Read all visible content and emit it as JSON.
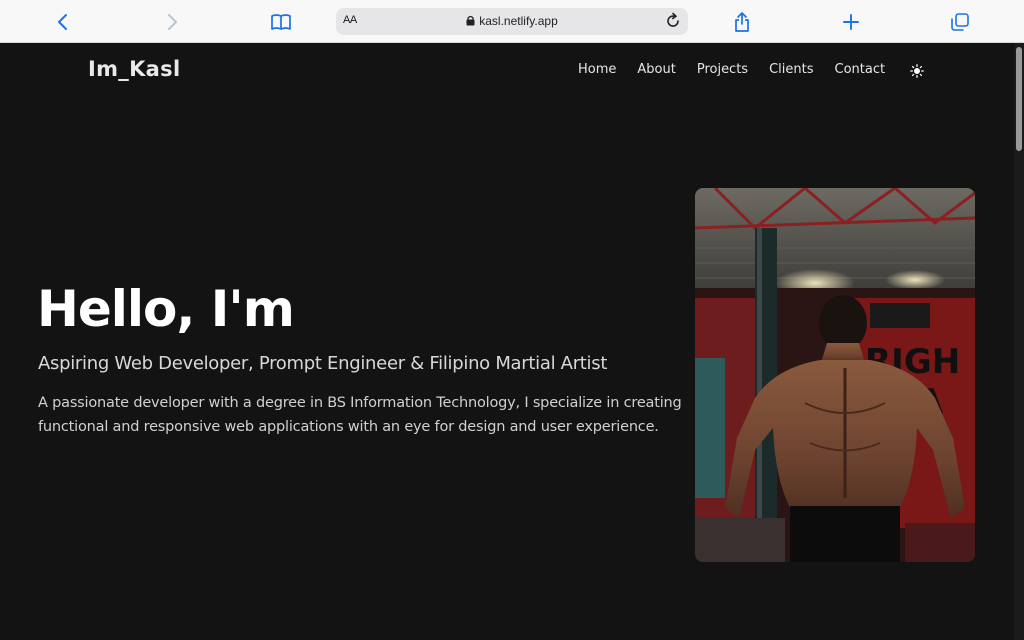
{
  "browser": {
    "address_prefix": "AA",
    "url": "kasl.netlify.app"
  },
  "site": {
    "logo": "Im_Kasl",
    "nav": [
      {
        "label": "Home"
      },
      {
        "label": "About"
      },
      {
        "label": "Projects"
      },
      {
        "label": "Clients"
      },
      {
        "label": "Contact"
      }
    ],
    "theme_toggle_icon": "sun-icon"
  },
  "hero": {
    "title": "Hello, I'm",
    "subtitle": "Aspiring Web Developer, Prompt Engineer & Filipino Martial Artist",
    "description": "A passionate developer with a degree in BS Information Technology, I specialize in creating functional and responsive web applications with an eye for design and user experience.",
    "image_subject": "back view of a man flexing in a gym"
  },
  "colors": {
    "page_bg": "#131313",
    "text": "#ffffff",
    "browser_accent": "#1a73e8"
  }
}
